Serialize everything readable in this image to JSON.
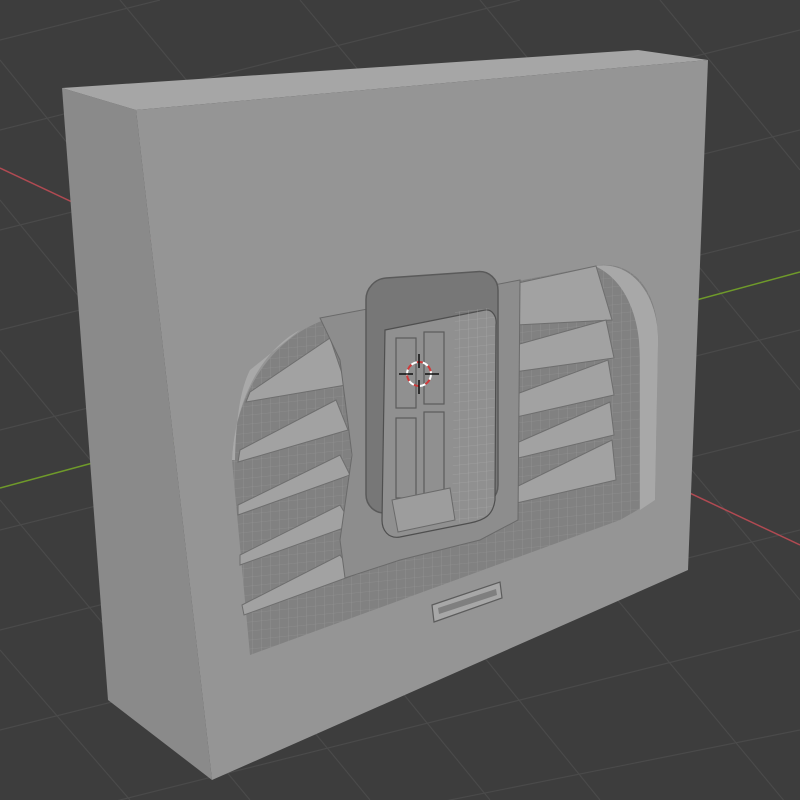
{
  "viewport": {
    "background": "#3d3d3d",
    "grid_color": "#4a4a4a",
    "x_axis_color": "#b04a52",
    "y_axis_color": "#6f9a2a"
  },
  "object": {
    "type": "wall-block-with-arched-vent-and-door",
    "front_face_color": "#959595",
    "top_face_color": "#a6a6a6",
    "side_face_color": "#8a8a8a",
    "recess_color": "#818181",
    "slat_color": "#9c9c9c",
    "wireframe_color": "#b8b8b8"
  },
  "gizmo": {
    "name": "3d-cursor-icon",
    "ring_color_a": "#d03a3a",
    "ring_color_b": "#ffffff"
  }
}
